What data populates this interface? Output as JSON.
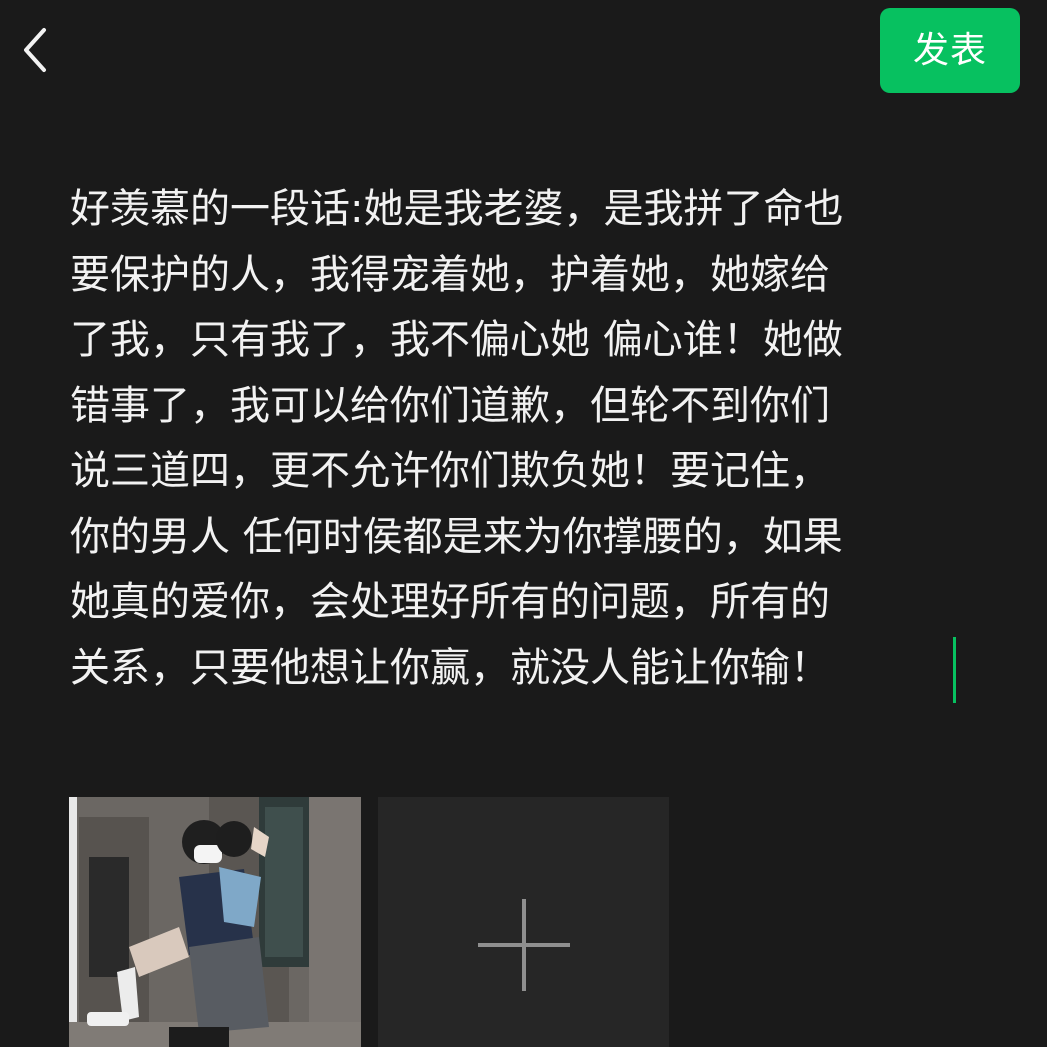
{
  "header": {
    "back_icon": "chevron-left-icon",
    "publish_label": "发表"
  },
  "composer": {
    "lines": [
      "好羡慕的一段话:她是我老婆，是我拼了命也",
      "要保护的人，我得宠着她，护着她，她嫁给",
      "了我，只有我了，我不偏心她 偏心谁！她做",
      "错事了，我可以给你们道歉，但轮不到你们",
      "说三道四，更不允许你们欺负她！要记住，",
      "你的男人 任何时侯都是来为你撑腰的，如果",
      "她真的爱你，会处理好所有的问题，所有的",
      "关系，只要他想让你赢，就没人能让你输！"
    ]
  },
  "attachments": {
    "add_icon": "plus-icon"
  },
  "colors": {
    "background": "#1a1a1a",
    "accent": "#07c160",
    "text": "#f2f2f2",
    "add_tile": "#262626"
  }
}
